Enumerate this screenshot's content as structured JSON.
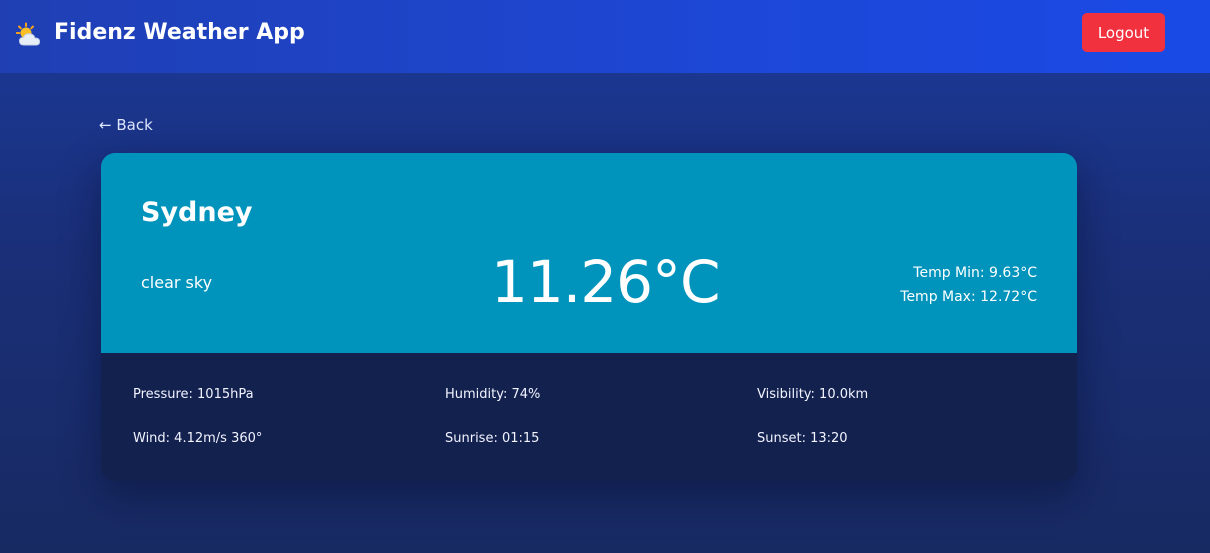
{
  "header": {
    "app_title": "Fidenz Weather App",
    "logo_icon": "sun-behind-cloud-icon",
    "logout_label": "Logout",
    "logout_color": "#f2313f"
  },
  "nav": {
    "back_label": "← Back"
  },
  "weather": {
    "city": "Sydney",
    "description": "clear sky",
    "temperature": "11.26°C",
    "temp_min": "Temp Min: 9.63°C",
    "temp_max": "Temp Max: 12.72°C",
    "top_color": "#0094bd",
    "bottom_color": "#13214f"
  },
  "details": {
    "pressure": "Pressure: 1015hPa",
    "humidity": "Humidity: 74%",
    "visibility": "Visibility: 10.0km",
    "wind": "Wind: 4.12m/s 360°",
    "sunrise": "Sunrise: 01:15",
    "sunset": "Sunset: 13:20"
  }
}
